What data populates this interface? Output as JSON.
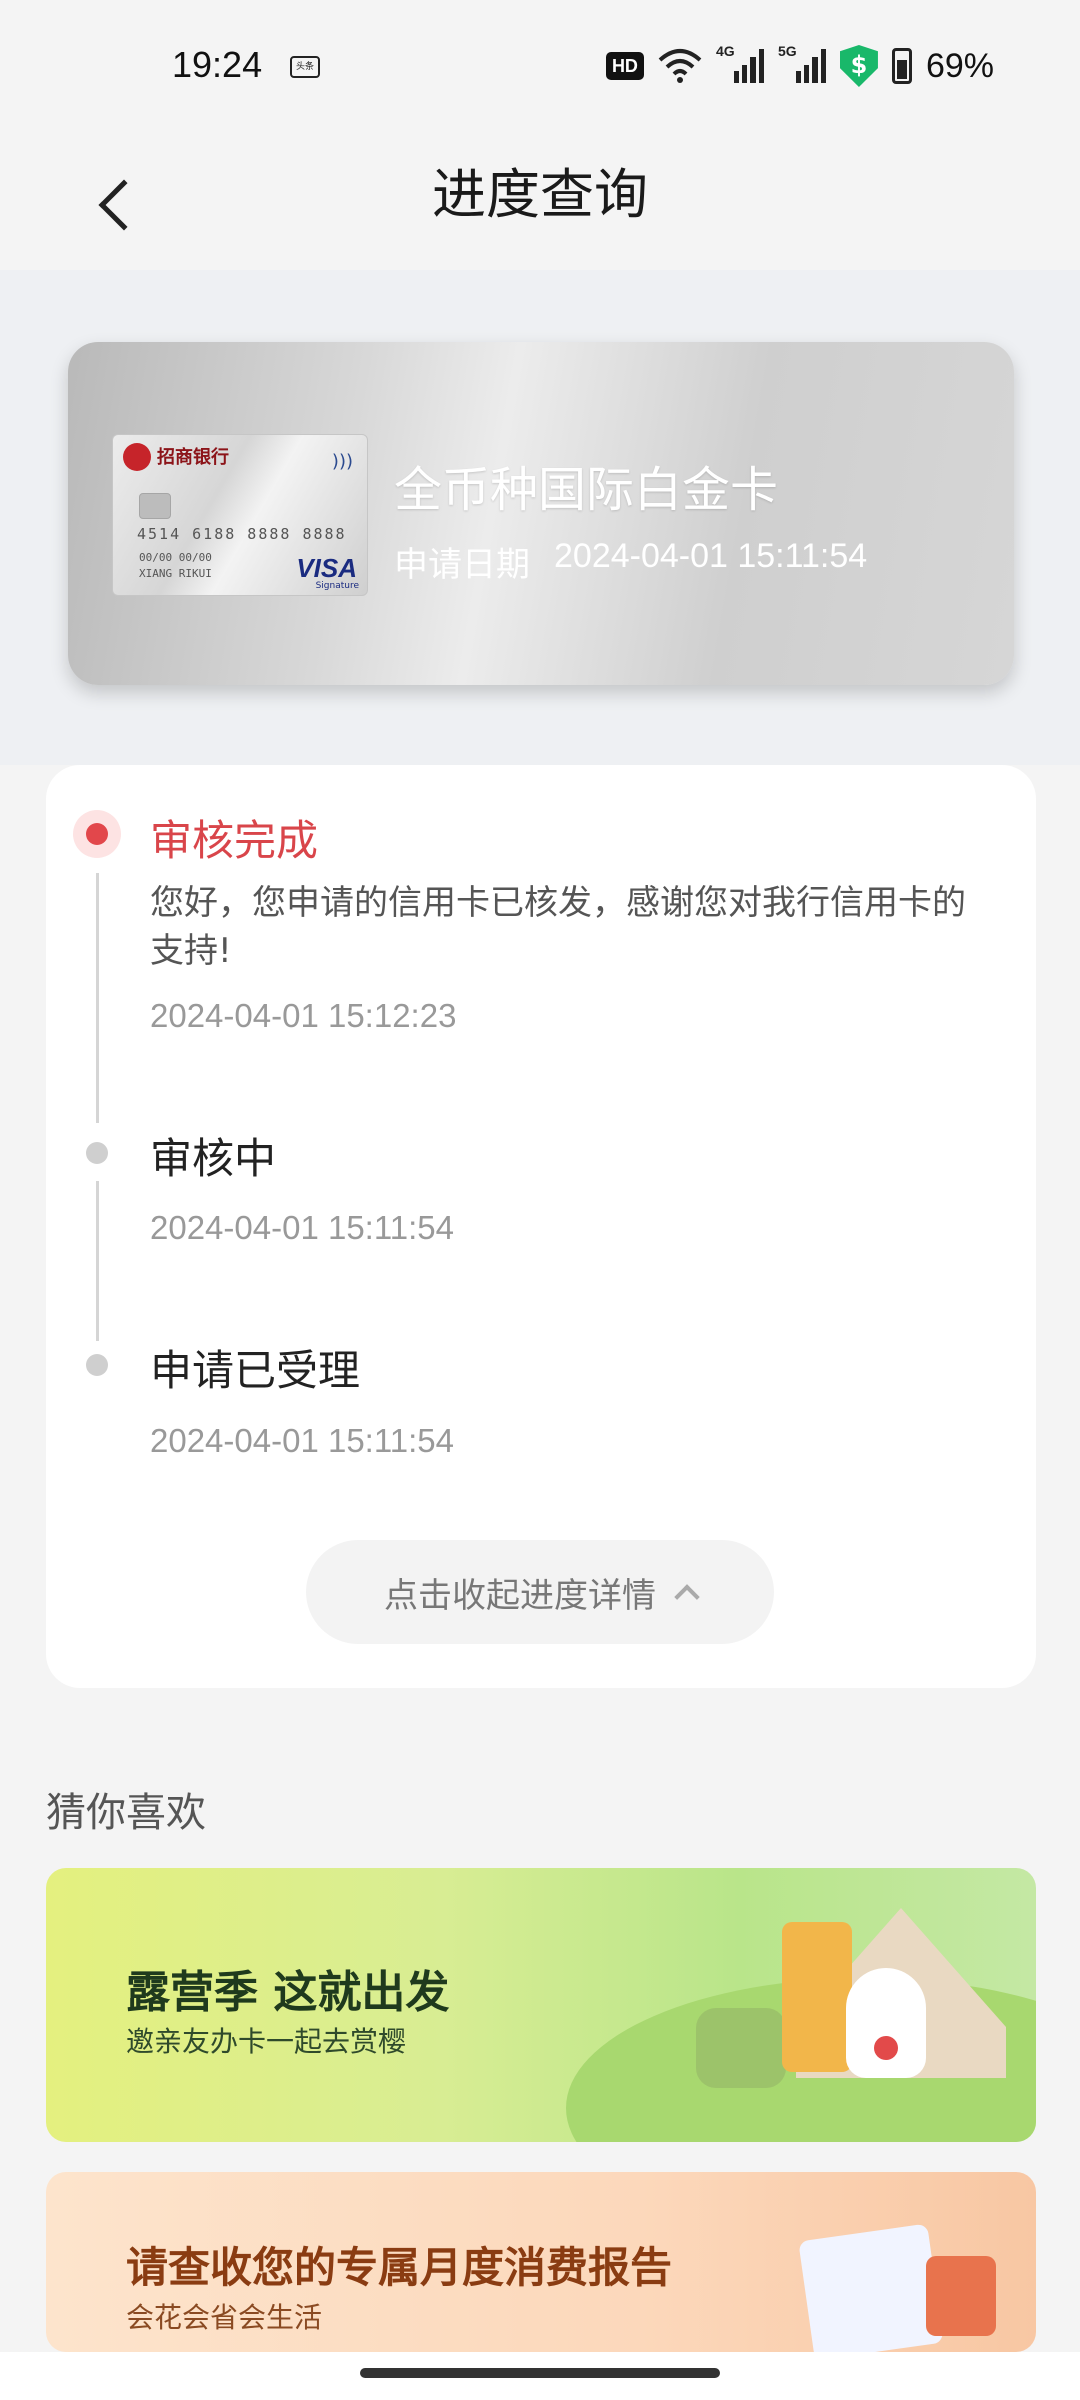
{
  "status_bar": {
    "time": "19:24",
    "app_icon": "头条",
    "hd_label": "HD",
    "sig1_label": "4G",
    "sig2_label": "5G",
    "shield_icon": "$",
    "battery_percent": "69%"
  },
  "header": {
    "title": "进度查询",
    "back_icon": "chevron-left-icon"
  },
  "card": {
    "bank_name": "招商银行",
    "card_number": "4514 6188 8888 8888",
    "expiry": "00/00  00/00",
    "holder": "XIANG RIKUI",
    "network": "VISA",
    "network_sub": "Signature",
    "title": "全币种国际白金卡",
    "date_label": "申请日期",
    "date_value": "2024-04-01 15:11:54"
  },
  "progress": {
    "steps": [
      {
        "title": "审核完成",
        "desc": "您好，您申请的信用卡已核发，感谢您对我行信用卡的支持!",
        "time": "2024-04-01 15:12:23",
        "status": "active"
      },
      {
        "title": "审核中",
        "time": "2024-04-01 15:11:54",
        "status": "done"
      },
      {
        "title": "申请已受理",
        "time": "2024-04-01 15:11:54",
        "status": "done"
      }
    ],
    "collapse_label": "点击收起进度详情"
  },
  "recommend": {
    "title": "猜你喜欢",
    "banners": [
      {
        "headline": "露营季 这就出发",
        "sub": "邀亲友办卡一起去赏樱"
      },
      {
        "headline": "请查收您的专属月度消费报告",
        "sub": "会花会省会生活"
      }
    ]
  },
  "colors": {
    "accent_red": "#e2474b",
    "background": "#f4f4f4"
  }
}
